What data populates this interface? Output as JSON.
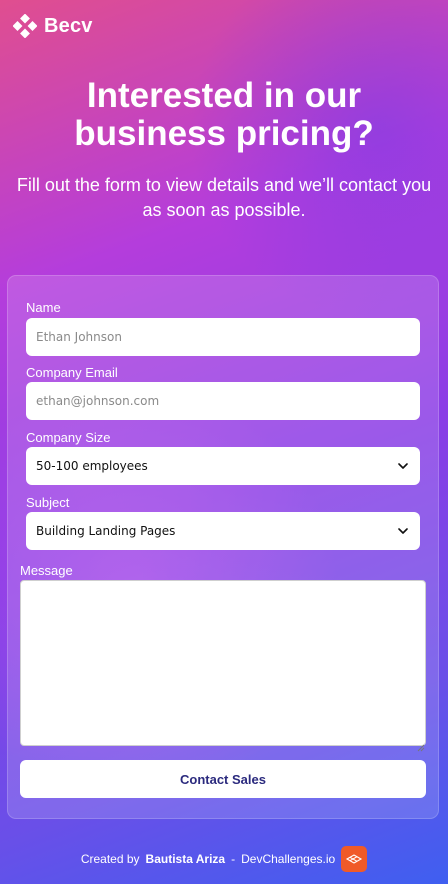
{
  "brand": {
    "name": "Becv",
    "icon": "diamond-cross-logo-icon"
  },
  "hero": {
    "title": "Interested in our business pricing?",
    "subtitle": "Fill out the form to view details and we’ll contact you as soon as possible."
  },
  "form": {
    "name": {
      "label": "Name",
      "placeholder": "Ethan Johnson"
    },
    "email": {
      "label": "Company Email",
      "placeholder": "ethan@johnson.com"
    },
    "size": {
      "label": "Company Size",
      "value": "50-100 employees"
    },
    "subject": {
      "label": "Subject",
      "value": "Building Landing Pages"
    },
    "message": {
      "label": "Message",
      "value": ""
    },
    "submit_label": "Contact Sales"
  },
  "footer": {
    "prefix": "Created by",
    "author": "Bautista Ariza",
    "separator": "-",
    "site": "DevChallenges.io",
    "icon": "devchallenges-logo-icon"
  },
  "colors": {
    "button_text": "#2b2a7e",
    "footer_logo": "#f05a28"
  }
}
